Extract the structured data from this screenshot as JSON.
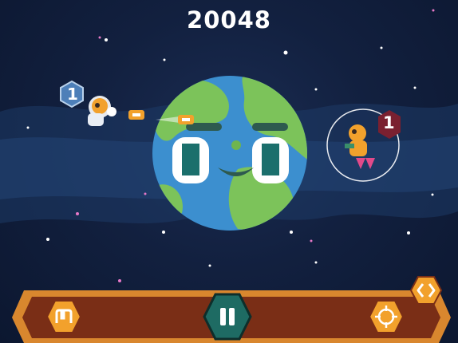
{
  "hud": {
    "score": "20048",
    "player_level": "1",
    "enemy_level": "1"
  },
  "controls": {
    "jump_icon": "jump-icon",
    "pause_icon": "pause-icon",
    "aim_icon": "crosshair-icon",
    "swap_icon": "swap-arrows-icon"
  },
  "colors": {
    "bar_fill": "#7a2e16",
    "bar_border": "#d9872e",
    "hex_button": "#f2a12c",
    "pause_button": "#1e6b63",
    "planet_ocean": "#3c8fcf",
    "planet_land": "#7cc35a"
  }
}
